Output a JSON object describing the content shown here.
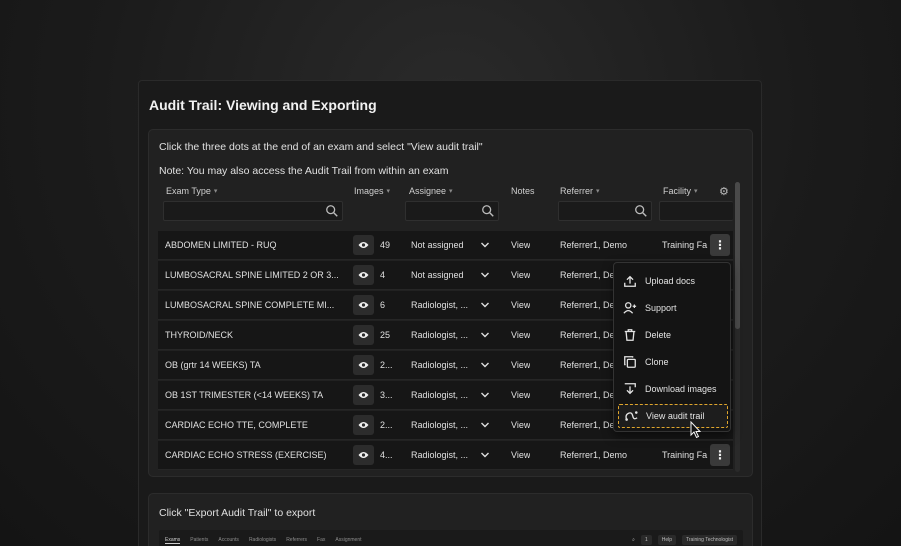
{
  "page_title": "Audit Trail: Viewing and Exporting",
  "instructions": {
    "line1": "Click the three dots at the end of an exam and select \"View audit trail\"",
    "line2": "Note: You may also access the Audit Trail from within an exam",
    "export": "Click \"Export Audit Trail\" to export"
  },
  "columns": {
    "exam_type": "Exam Type",
    "images": "Images",
    "assignee": "Assignee",
    "notes": "Notes",
    "referrer": "Referrer",
    "facility": "Facility"
  },
  "rows": [
    {
      "exam": "ABDOMEN LIMITED - RUQ",
      "images": "49",
      "assignee": "Not assigned",
      "notes": "View",
      "referrer": "Referrer1, Demo",
      "facility": "Training Fa"
    },
    {
      "exam": "LUMBOSACRAL SPINE LIMITED 2 OR 3...",
      "images": "4",
      "assignee": "Not assigned",
      "notes": "View",
      "referrer": "Referrer1, De",
      "facility": ""
    },
    {
      "exam": "LUMBOSACRAL SPINE COMPLETE MI...",
      "images": "6",
      "assignee": "Radiologist, ...",
      "notes": "View",
      "referrer": "Referrer1, De",
      "facility": ""
    },
    {
      "exam": "THYROID/NECK",
      "images": "25",
      "assignee": "Radiologist, ...",
      "notes": "View",
      "referrer": "Referrer1, De",
      "facility": ""
    },
    {
      "exam": "OB (grtr 14 WEEKS) TA",
      "images": "2...",
      "assignee": "Radiologist, ...",
      "notes": "View",
      "referrer": "Referrer1, De",
      "facility": ""
    },
    {
      "exam": "OB 1ST TRIMESTER (<14 WEEKS) TA",
      "images": "3...",
      "assignee": "Radiologist, ...",
      "notes": "View",
      "referrer": "Referrer1, De",
      "facility": ""
    },
    {
      "exam": "CARDIAC ECHO TTE, COMPLETE",
      "images": "2...",
      "assignee": "Radiologist, ...",
      "notes": "View",
      "referrer": "Referrer1, De",
      "facility": ""
    },
    {
      "exam": "CARDIAC ECHO STRESS (EXERCISE)",
      "images": "4...",
      "assignee": "Radiologist, ...",
      "notes": "View",
      "referrer": "Referrer1, Demo",
      "facility": "Training Fa"
    }
  ],
  "menu": {
    "upload_docs": "Upload docs",
    "support": "Support",
    "delete": "Delete",
    "clone": "Clone",
    "download_images": "Download images",
    "view_audit_trail": "View audit trail"
  },
  "mini_nav": {
    "tabs": [
      "Exams",
      "Patients",
      "Accounts",
      "Radiologists",
      "Referrers",
      "Fax",
      "Assignment"
    ],
    "count": "1",
    "help": "Help",
    "user": "Training Technologist"
  },
  "colors": {
    "highlight": "#e0a62c",
    "row_bg": "#161616",
    "card_bg": "#212121"
  }
}
